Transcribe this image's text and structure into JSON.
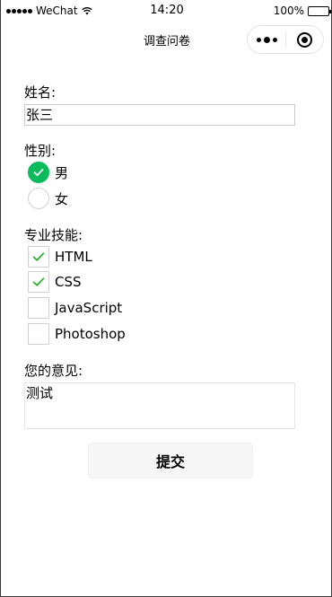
{
  "status_bar": {
    "carrier": "WeChat",
    "time": "14:20",
    "battery": "100%",
    "battery_level": 1.0
  },
  "nav": {
    "title": "调查问卷"
  },
  "form": {
    "name_label": "姓名:",
    "name_value": "张三",
    "gender_label": "性别:",
    "gender_options": [
      {
        "label": "男",
        "checked": true
      },
      {
        "label": "女",
        "checked": false
      }
    ],
    "skills_label": "专业技能:",
    "skills_options": [
      {
        "label": "HTML",
        "checked": true
      },
      {
        "label": "CSS",
        "checked": true
      },
      {
        "label": "JavaScript",
        "checked": false
      },
      {
        "label": "Photoshop",
        "checked": false
      }
    ],
    "opinion_label": "您的意见:",
    "opinion_value": "测试",
    "submit_label": "提交"
  },
  "colors": {
    "accent_green": "#09bb5a",
    "check_green": "#1aad19"
  }
}
